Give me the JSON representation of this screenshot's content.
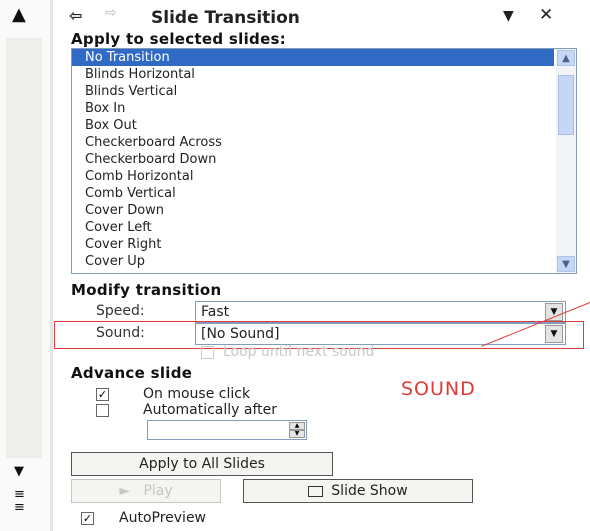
{
  "pane": {
    "title": "Slide Transition",
    "back_glyph": "⇦",
    "forward_glyph": "⇨",
    "menu_glyph": "▼",
    "close_glyph": "✕"
  },
  "apply_section": {
    "heading": "Apply to selected slides:",
    "transitions": [
      {
        "label": "No Transition",
        "selected": true
      },
      {
        "label": "Blinds Horizontal"
      },
      {
        "label": "Blinds Vertical"
      },
      {
        "label": "Box In"
      },
      {
        "label": "Box Out"
      },
      {
        "label": "Checkerboard Across"
      },
      {
        "label": "Checkerboard Down"
      },
      {
        "label": "Comb Horizontal"
      },
      {
        "label": "Comb Vertical"
      },
      {
        "label": "Cover Down"
      },
      {
        "label": "Cover Left"
      },
      {
        "label": "Cover Right"
      },
      {
        "label": "Cover Up"
      }
    ]
  },
  "modify_section": {
    "heading": "Modify transition",
    "speed_label": "Speed:",
    "speed_value": "Fast",
    "sound_label": "Sound:",
    "sound_value": "[No Sound]",
    "loop_label": "Loop until next sound"
  },
  "advance_section": {
    "heading": "Advance slide",
    "on_click_label": "On mouse click",
    "on_click_checked": true,
    "auto_label": "Automatically after",
    "auto_checked": false,
    "auto_value": ""
  },
  "annotation_text": "SOUND",
  "buttons": {
    "apply_all": "Apply to All Slides",
    "play": "Play",
    "slide_show": "Slide Show"
  },
  "autopreview": {
    "label": "AutoPreview",
    "checked": true
  },
  "colors": {
    "selection": "#316ac5",
    "annotation": "#e03a3a",
    "listbox_border": "#7f9db9"
  }
}
